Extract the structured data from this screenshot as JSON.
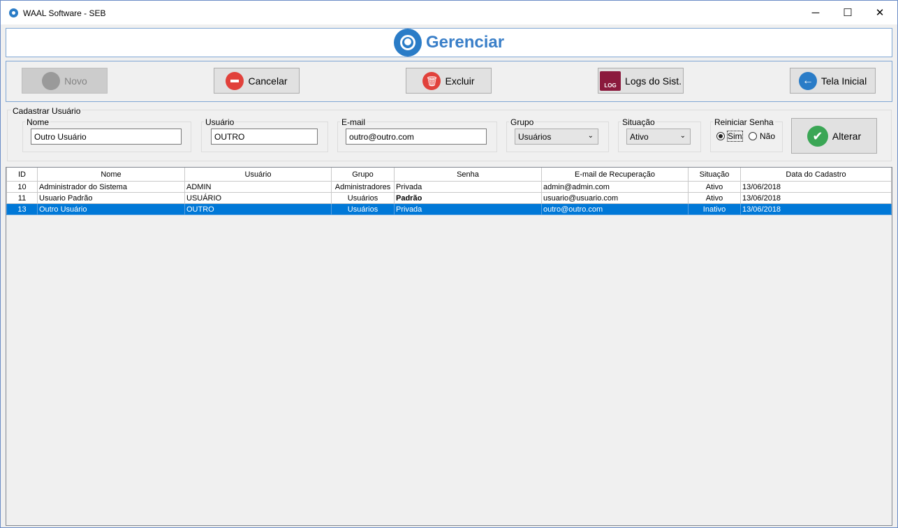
{
  "window": {
    "title": "WAAL Software - SEB",
    "minimize": "─",
    "maximize": "☐",
    "close": "✕"
  },
  "header": {
    "title": "Gerenciar"
  },
  "toolbar": {
    "novo": "Novo",
    "cancelar": "Cancelar",
    "excluir": "Excluir",
    "logs": "Logs do Sist.",
    "logs_icon_text": "LOG",
    "tela_inicial": "Tela Inicial"
  },
  "form": {
    "legend": "Cadastrar Usuário",
    "nome_label": "Nome",
    "nome_value": "Outro Usuário",
    "usuario_label": "Usuário",
    "usuario_value": "OUTRO",
    "email_label": "E-mail",
    "email_value": "outro@outro.com",
    "grupo_label": "Grupo",
    "grupo_value": "Usuários",
    "situacao_label": "Situação",
    "situacao_value": "Ativo",
    "reiniciar_label": "Reiniciar Senha",
    "sim": "Sim",
    "nao": "Não",
    "selected_option": "Sim",
    "alterar": "Alterar"
  },
  "table": {
    "headers": [
      "ID",
      "Nome",
      "Usuário",
      "Grupo",
      "Senha",
      "E-mail de Recuperação",
      "Situação",
      "Data do Cadastro"
    ],
    "rows": [
      [
        "10",
        "Administrador do Sistema",
        "ADMIN",
        "Administradores",
        "Privada",
        "admin@admin.com",
        "Ativo",
        "13/06/2018"
      ],
      [
        "11",
        "Usuario Padrão",
        "USUÁRIO",
        "Usuários",
        "Padrão",
        "usuario@usuario.com",
        "Ativo",
        "13/06/2018"
      ],
      [
        "13",
        "Outro Usuário",
        "OUTRO",
        "Usuários",
        "Privada",
        "outro@outro.com",
        "Inativo",
        "13/06/2018"
      ]
    ],
    "selected_row_index": 2
  },
  "colors": {
    "accent": "#2a7cc7",
    "selection": "#0078d7",
    "danger": "#e1413b",
    "success": "#3aa655"
  }
}
